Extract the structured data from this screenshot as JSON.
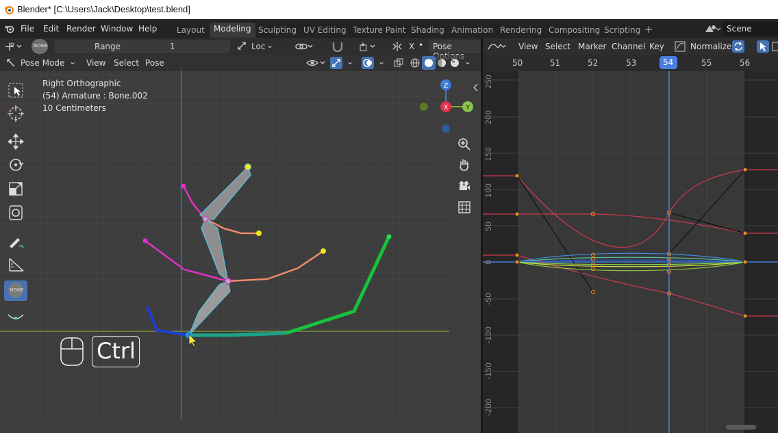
{
  "window": {
    "title": "Blender* [C:\\Users\\Jack\\Desktop\\test.blend]"
  },
  "menu": {
    "items": [
      "File",
      "Edit",
      "Render",
      "Window",
      "Help"
    ]
  },
  "workspaces": {
    "tabs": [
      "Layout",
      "Modeling",
      "Sculpting",
      "UV Editing",
      "Texture Paint",
      "Shading",
      "Animation",
      "Rendering",
      "Compositing",
      "Scripting"
    ],
    "active": "Modeling",
    "add": "+"
  },
  "scene": {
    "name": "Scene"
  },
  "viewport": {
    "tool_header": {
      "none_label": "NONE",
      "range_label": "Range",
      "range_value": "1",
      "transform": "Loc",
      "pose_options": "Pose Options",
      "x_label": "X"
    },
    "header": {
      "mode": "Pose Mode",
      "view": "View",
      "select": "Select",
      "pose": "Pose"
    },
    "overlay_text": {
      "view_name": "Right Orthographic",
      "object": "(54) Armature : Bone.002",
      "scale": "10 Centimeters"
    },
    "gizmo": {
      "z": "Z",
      "x": "X",
      "y": "Y"
    },
    "key_hint": {
      "label": "Ctrl"
    },
    "toolbar_none": "NONE"
  },
  "graph_editor": {
    "menu": [
      "View",
      "Select",
      "Marker",
      "Channel",
      "Key"
    ],
    "normalize": "Normalize",
    "frames": [
      "50",
      "51",
      "52",
      "53",
      "54",
      "55",
      "56"
    ],
    "current_frame": "54",
    "y_labels": [
      "250",
      "200",
      "150",
      "100",
      "50",
      "0",
      "-50",
      "-100",
      "-150",
      "-200"
    ]
  },
  "colors": {
    "accent": "#4772b3",
    "current_frame": "#4b7ee0",
    "selected_key": "#f08c1e"
  }
}
